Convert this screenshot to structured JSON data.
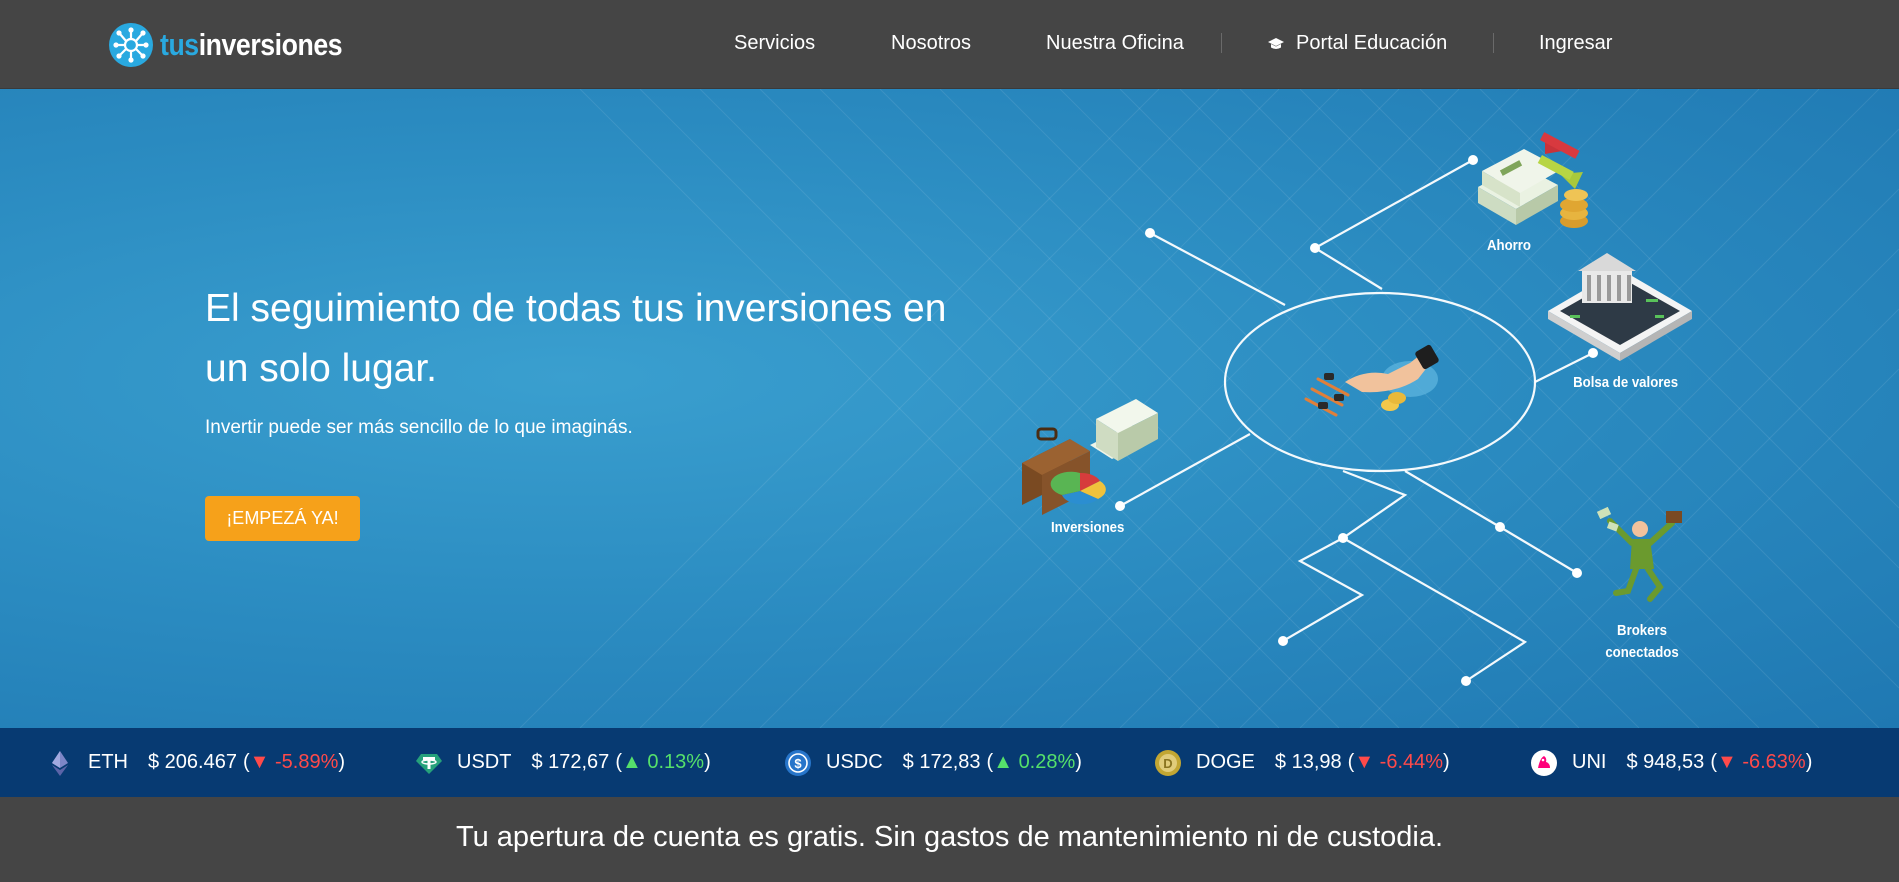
{
  "navbar": {
    "logo": {
      "prefix": "tus",
      "suffix": "inversiones"
    },
    "items": [
      {
        "label": "Servicios"
      },
      {
        "label": "Nosotros"
      },
      {
        "label": "Nuestra Oficina"
      },
      {
        "label": "Portal Educación",
        "icon": "graduation-cap-icon"
      },
      {
        "label": "Ingresar"
      }
    ]
  },
  "hero": {
    "title": "El seguimiento de todas tus inversiones en un solo lugar.",
    "subtitle": "Invertir puede ser más sencillo de lo que imaginás.",
    "cta_label": "¡EMPEZÁ YA!",
    "diagram": {
      "labels": [
        "Ahorro",
        "Bolsa de valores",
        "Inversiones",
        "Brokers conectados"
      ]
    }
  },
  "ticker": [
    {
      "symbol": "ETH",
      "price": "$ 206.467",
      "change": "-5.89%",
      "direction": "down",
      "arrow": "▼",
      "icon": "ethereum-icon"
    },
    {
      "symbol": "USDT",
      "price": "$ 172,67",
      "change": "0.13%",
      "direction": "up",
      "arrow": "▲",
      "icon": "tether-icon"
    },
    {
      "symbol": "USDC",
      "price": "$ 172,83",
      "change": "0.28%",
      "direction": "up",
      "arrow": "▲",
      "icon": "usd-coin-icon"
    },
    {
      "symbol": "DOGE",
      "price": "$ 13,98",
      "change": "-6.44%",
      "direction": "down",
      "arrow": "▼",
      "icon": "dogecoin-icon"
    },
    {
      "symbol": "UNI",
      "price": "$ 948,53",
      "change": "-6.63%",
      "direction": "down",
      "arrow": "▼",
      "icon": "uniswap-icon"
    }
  ],
  "banner": {
    "text": "Tu apertura de cuenta es gratis. Sin gastos de mantenimiento ni de custodia."
  },
  "colors": {
    "navbar_bg": "#454545",
    "hero_blue": "#2c8dc2",
    "accent_orange": "#f6a11a",
    "logo_blue": "#29a9e0",
    "ticker_bg": "#073a72",
    "up_green": "#55e06b",
    "down_red": "#ff4a4a"
  }
}
